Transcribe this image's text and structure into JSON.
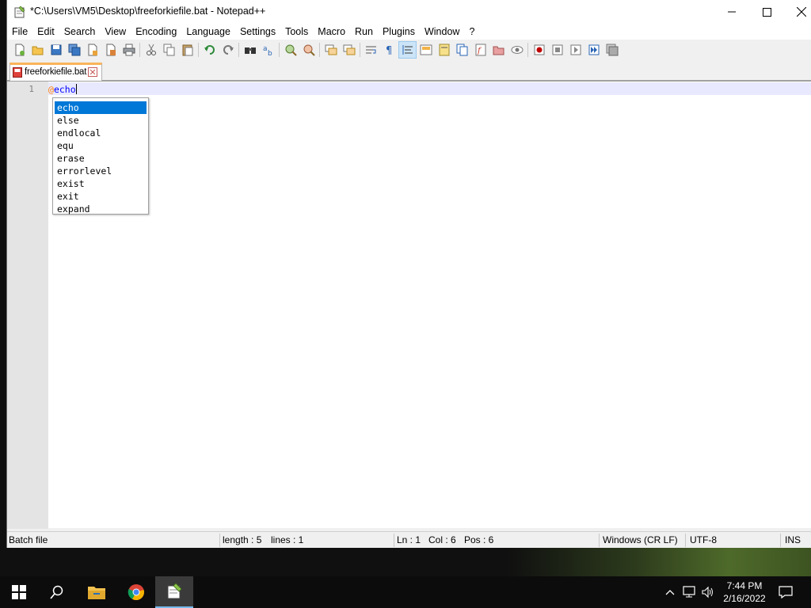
{
  "window": {
    "title": "*C:\\Users\\VM5\\Desktop\\freeforkiefile.bat - Notepad++",
    "controls": {
      "minimize": "minimize",
      "maximize": "maximize",
      "close": "close"
    }
  },
  "menubar": {
    "items": [
      "File",
      "Edit",
      "Search",
      "View",
      "Encoding",
      "Language",
      "Settings",
      "Tools",
      "Macro",
      "Run",
      "Plugins",
      "Window",
      "?"
    ],
    "close_doc": "✕"
  },
  "toolbar": {
    "buttons": [
      "new-file-icon",
      "open-file-icon",
      "save-icon",
      "save-all-icon",
      "close-icon",
      "close-all-icon",
      "print-icon",
      "cut-icon",
      "copy-icon",
      "paste-icon",
      "undo-icon",
      "redo-icon",
      "find-icon",
      "replace-icon",
      "zoom-in-icon",
      "zoom-out-icon",
      "sync-vertical-icon",
      "sync-horizontal-icon",
      "word-wrap-icon",
      "show-all-characters-icon",
      "indent-guide-icon",
      "user-language-icon",
      "doc-map-icon",
      "document-list-icon",
      "function-list-icon",
      "folder-as-workspace-icon",
      "monitoring-icon",
      "record-macro-icon",
      "stop-recording-icon",
      "playback-macro-icon",
      "run-macro-multiple-icon",
      "save-macro-icon"
    ]
  },
  "tabs": [
    {
      "label": "freeforkiefile.bat",
      "active": true
    }
  ],
  "editor": {
    "line_number": "1",
    "code_at": "@",
    "code_keyword": "echo"
  },
  "autocomplete": {
    "items": [
      "echo",
      "else",
      "endlocal",
      "equ",
      "erase",
      "errorlevel",
      "exist",
      "exit",
      "expand"
    ],
    "selected": "echo"
  },
  "statusbar": {
    "file_type": "Batch file",
    "length": "length : 5",
    "lines": "lines : 1",
    "ln": "Ln : 1",
    "col": "Col : 6",
    "pos": "Pos : 6",
    "eol": "Windows (CR LF)",
    "encoding": "UTF-8",
    "mode": "INS"
  },
  "taskbar": {
    "apps": [
      "start-icon",
      "search-icon",
      "file-explorer-icon",
      "chrome-icon",
      "notepad-plus-plus-icon"
    ],
    "tray": [
      "show-hidden-icons-icon",
      "network-icon",
      "volume-icon",
      "notifications-icon"
    ],
    "time": "7:44 PM",
    "date": "2/16/2022"
  },
  "colors": {
    "selection": "#0078d7",
    "tab_accent": "#fab45a",
    "current_line": "#e8e8ff",
    "keyword": "#0000ff",
    "operator": "#ff8000"
  }
}
